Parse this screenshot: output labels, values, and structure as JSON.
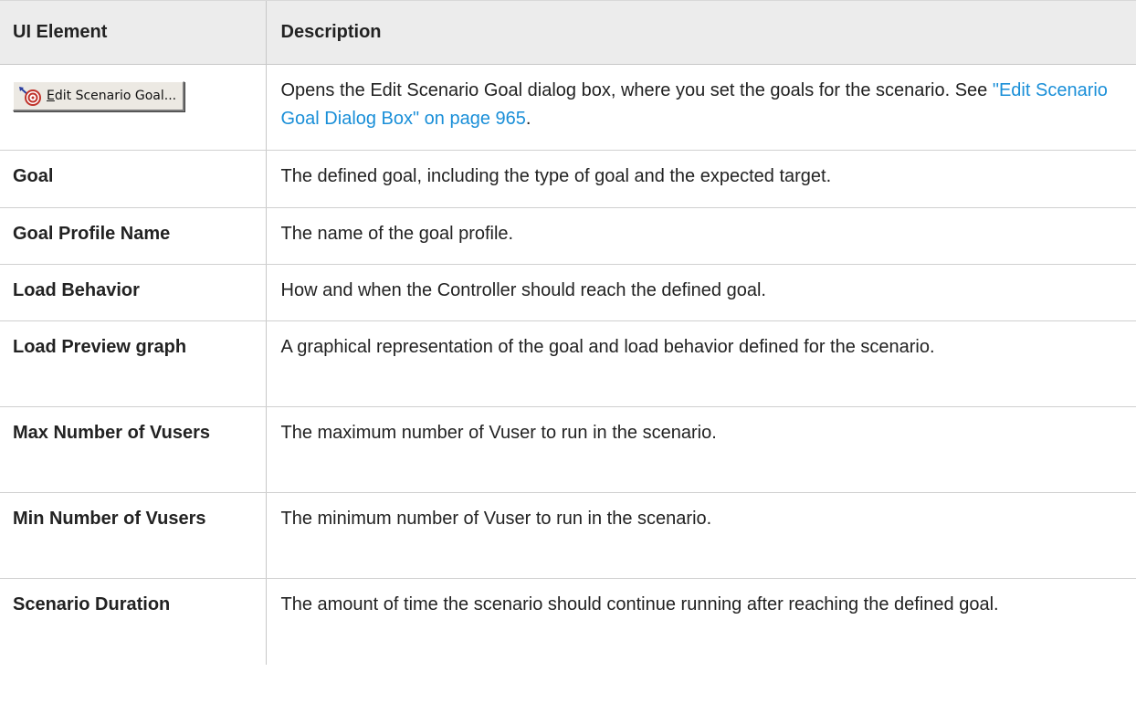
{
  "table": {
    "headers": {
      "ui_element": "UI Element",
      "description": "Description"
    },
    "rows": [
      {
        "element_button_label": "Edit Scenario Goal...",
        "element_icon": "target-icon",
        "description_before": "Opens the Edit Scenario Goal dialog box, where you set the goals for the scenario. See ",
        "description_link": "\"Edit Scenario Goal Dialog Box\" on page 965",
        "description_after": "."
      },
      {
        "element": "Goal",
        "description": "The defined goal, including the type of goal and the expected target."
      },
      {
        "element": "Goal Profile Name",
        "description": "The name of the goal profile."
      },
      {
        "element": "Load Behavior",
        "description": "How and when the Controller should reach the defined goal."
      },
      {
        "element": "Load Preview graph",
        "description": "A graphical representation of the goal and load behavior defined for the scenario."
      },
      {
        "element": "Max Number of Vusers",
        "description": "The maximum number of Vuser to run in the scenario."
      },
      {
        "element": "Min Number of Vusers",
        "description": "The minimum number of Vuser to run in the scenario."
      },
      {
        "element": "Scenario Duration",
        "description": "The amount of time the scenario should continue running after reaching the defined goal."
      }
    ]
  },
  "colors": {
    "header_bg": "#ececec",
    "link": "#1a8fd8",
    "border": "#c8c8c8"
  }
}
